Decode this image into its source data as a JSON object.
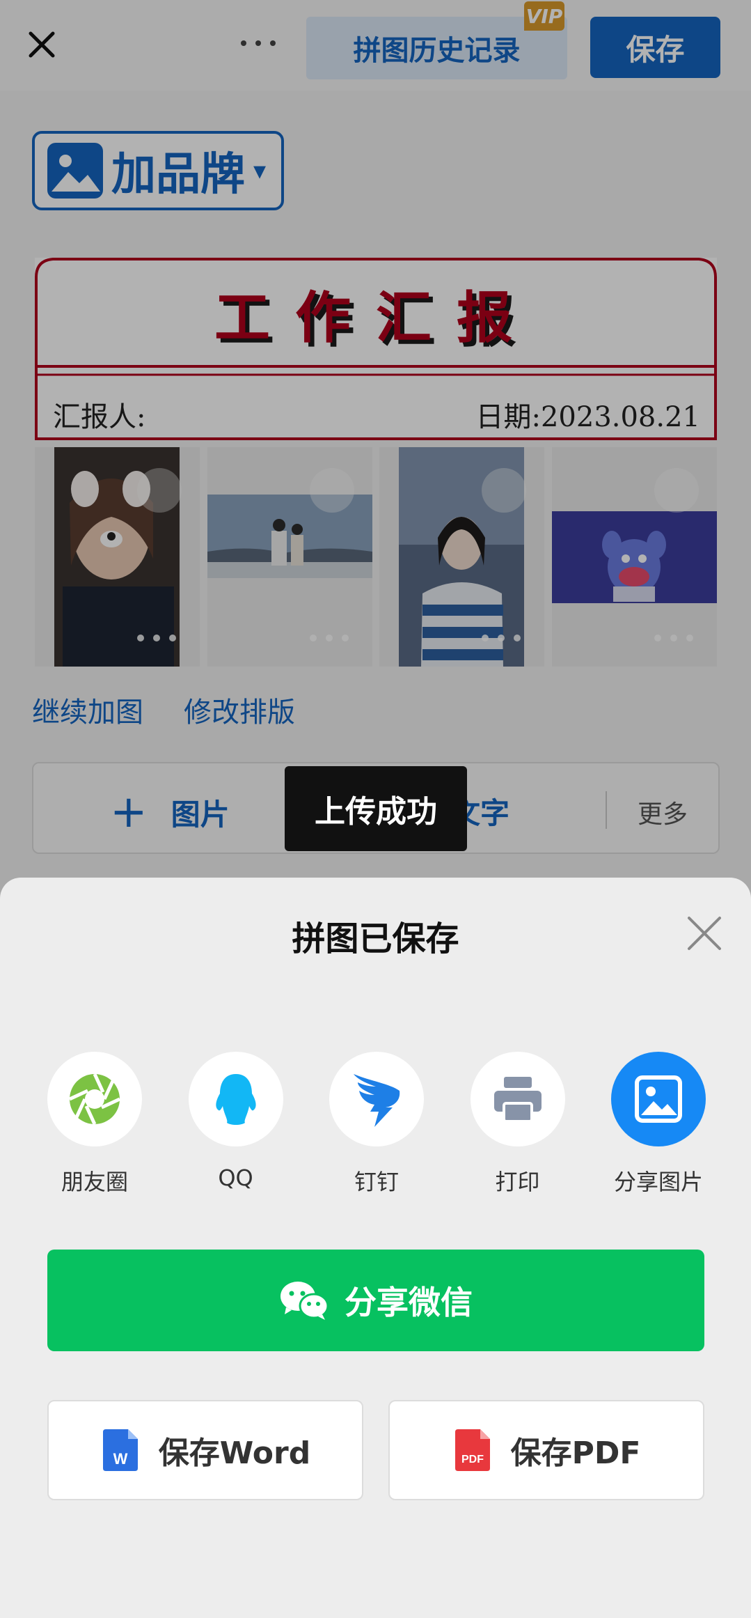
{
  "topbar": {
    "history_label": "拼图历史记录",
    "vip_badge": "VIP",
    "save_label": "保存"
  },
  "brand": {
    "label": "加品牌",
    "caret": "▾"
  },
  "report": {
    "title": "工作汇报",
    "reporter_label": "汇报人:",
    "date_label": "日期:2023.08.21"
  },
  "links": {
    "continue_add": "继续加图",
    "edit_layout": "修改排版"
  },
  "toolbar": {
    "add_image_label": "图片",
    "add_text_label": "文字",
    "more_label": "更多"
  },
  "toast": "上传成功",
  "sheet": {
    "title": "拼图已保存",
    "share_targets": [
      {
        "label": "朋友圈",
        "icon": "moments-shutter-icon"
      },
      {
        "label": "QQ",
        "icon": "qq-penguin-icon"
      },
      {
        "label": "钉钉",
        "icon": "dingtalk-icon"
      },
      {
        "label": "打印",
        "icon": "printer-icon"
      },
      {
        "label": "分享图片",
        "icon": "image-icon"
      }
    ],
    "wechat_label": "分享微信",
    "save_word_label": "保存Word",
    "save_pdf_label": "保存PDF"
  },
  "colors": {
    "brand_blue": "#1565c0",
    "wechat_green": "#07c160",
    "report_red": "#b0001c",
    "share_blue": "#1689f5"
  }
}
